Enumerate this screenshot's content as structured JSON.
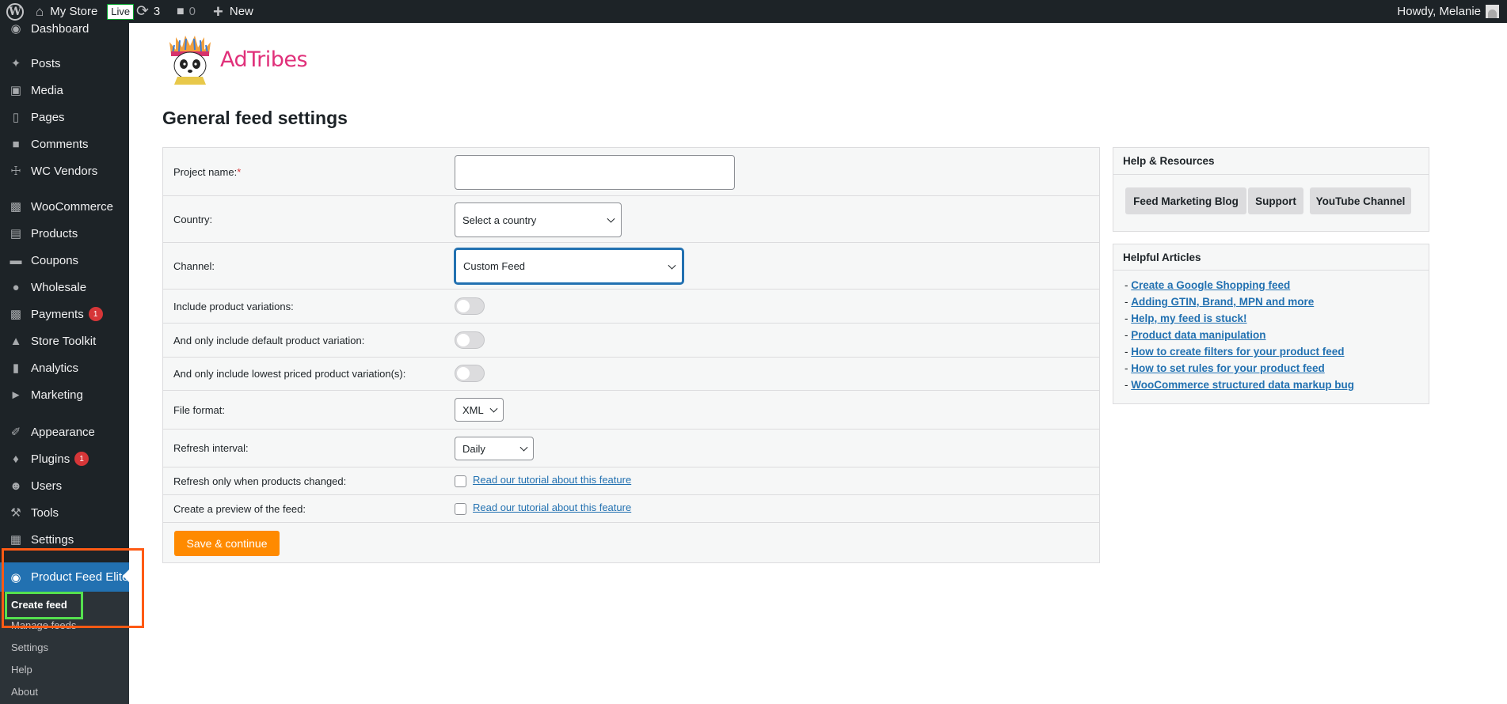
{
  "admin_bar": {
    "site_name": "My Store",
    "live_badge": "Live",
    "updates_count": "3",
    "comments_count": "0",
    "new_label": "New",
    "howdy": "Howdy, Melanie"
  },
  "sidebar": {
    "items": [
      {
        "label": "Dashboard",
        "icon": "dashboard-icon"
      },
      {
        "label": "Posts",
        "icon": "pin-icon"
      },
      {
        "label": "Media",
        "icon": "media-icon"
      },
      {
        "label": "Pages",
        "icon": "pages-icon"
      },
      {
        "label": "Comments",
        "icon": "comment-icon"
      },
      {
        "label": "WC Vendors",
        "icon": "cart-icon"
      },
      {
        "label": "WooCommerce",
        "icon": "woo-icon"
      },
      {
        "label": "Products",
        "icon": "archive-icon"
      },
      {
        "label": "Coupons",
        "icon": "ticket-icon"
      },
      {
        "label": "Wholesale",
        "icon": "wholesale-icon"
      },
      {
        "label": "Payments",
        "icon": "payments-icon",
        "badge": "1"
      },
      {
        "label": "Store Toolkit",
        "icon": "store-icon"
      },
      {
        "label": "Analytics",
        "icon": "chart-bar-icon"
      },
      {
        "label": "Marketing",
        "icon": "megaphone-icon"
      },
      {
        "label": "Appearance",
        "icon": "brush-icon"
      },
      {
        "label": "Plugins",
        "icon": "plugin-icon",
        "badge": "1"
      },
      {
        "label": "Users",
        "icon": "user-icon"
      },
      {
        "label": "Tools",
        "icon": "wrench-icon"
      },
      {
        "label": "Settings",
        "icon": "settings-icon"
      },
      {
        "label": "Product Feed Elite",
        "icon": "feed-icon"
      }
    ],
    "submenu": [
      "Create feed",
      "Manage feeds",
      "Settings",
      "Help",
      "About"
    ]
  },
  "brand": {
    "name": "AdTribes",
    "color": "#e0307a"
  },
  "page_title": "General feed settings",
  "form": {
    "project_name_label": "Project name:",
    "required_mark": "*",
    "project_name_value": "",
    "country_label": "Country:",
    "country_value": "Select a country",
    "channel_label": "Channel:",
    "channel_value": "Custom Feed",
    "variations_label": "Include product variations:",
    "default_variation_label": "And only include default product variation:",
    "lowest_variation_label": "And only include lowest priced product variation(s):",
    "variations_on": false,
    "default_variation_on": false,
    "lowest_variation_on": false,
    "file_format_label": "File format:",
    "file_format_value": "XML",
    "refresh_label": "Refresh interval:",
    "refresh_value": "Daily",
    "refresh_changed_label": "Refresh only when products changed:",
    "refresh_changed_checked": false,
    "preview_label": "Create a preview of the feed:",
    "preview_checked": false,
    "tutorial_link": "Read our tutorial about this feature",
    "save_button": "Save & continue"
  },
  "help_resources": {
    "title": "Help & Resources",
    "buttons": [
      "Feed Marketing Blog",
      "Support",
      "YouTube Channel"
    ]
  },
  "helpful_articles": {
    "title": "Helpful Articles",
    "prefix": "- ",
    "items": [
      "Create a Google Shopping feed",
      "Adding GTIN, Brand, MPN and more",
      "Help, my feed is stuck!",
      "Product data manipulation",
      "How to create filters for your product feed",
      "How to set rules for your product feed",
      "WooCommerce structured data markup bug"
    ]
  },
  "colors": {
    "admin_bg": "#1d2327",
    "current_menu": "#2271b1",
    "save_button": "#ff8a00",
    "highlight_orange": "#ff5a14",
    "highlight_green": "#55e04f",
    "badge": "#d63638"
  }
}
